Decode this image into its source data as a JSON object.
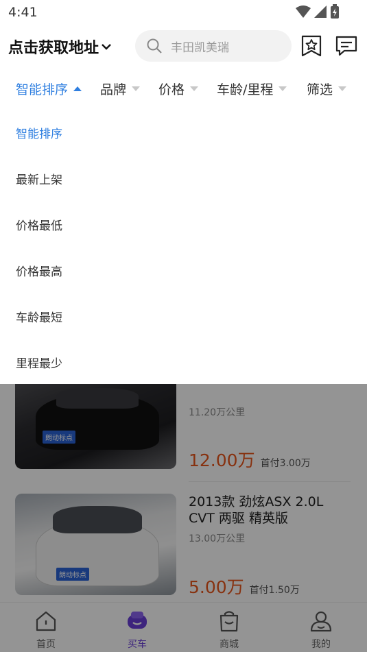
{
  "status_bar": {
    "time": "4:41",
    "icons": [
      "wifi-icon",
      "signal-icon",
      "battery-charging-icon"
    ]
  },
  "header": {
    "location_label": "点击获取地址",
    "search_placeholder": "丰田凯美瑞",
    "icons": [
      "search-icon",
      "favorites-icon",
      "message-icon"
    ]
  },
  "filters": [
    {
      "label": "智能排序",
      "active": true
    },
    {
      "label": "品牌",
      "active": false
    },
    {
      "label": "价格",
      "active": false
    },
    {
      "label": "车龄/里程",
      "active": false
    },
    {
      "label": "筛选",
      "active": false
    }
  ],
  "sort_options": [
    {
      "label": "智能排序",
      "selected": true
    },
    {
      "label": "最新上架",
      "selected": false
    },
    {
      "label": "价格最低",
      "selected": false
    },
    {
      "label": "价格最高",
      "selected": false
    },
    {
      "label": "车龄最短",
      "selected": false
    },
    {
      "label": "里程最少",
      "selected": false
    }
  ],
  "listings": [
    {
      "title": "",
      "plate": "朗动标点",
      "mileage": "11.20万公里",
      "price": "12.00万",
      "down_payment": "首付3.00万"
    },
    {
      "title": "2013款 劲炫ASX 2.0L CVT 两驱 精英版",
      "plate": "朗动标点",
      "mileage": "13.00万公里",
      "price": "5.00万",
      "down_payment": "首付1.50万"
    }
  ],
  "bottom_nav": [
    {
      "label": "首页",
      "icon": "home-icon",
      "active": false
    },
    {
      "label": "买车",
      "icon": "buy-car-icon",
      "active": true
    },
    {
      "label": "商城",
      "icon": "mall-bag-icon",
      "active": false
    },
    {
      "label": "我的",
      "icon": "profile-icon",
      "active": false
    }
  ],
  "colors": {
    "accent_blue": "#2f7fe0",
    "price_orange": "#e9561c",
    "nav_active_purple": "#6a3ed8"
  }
}
